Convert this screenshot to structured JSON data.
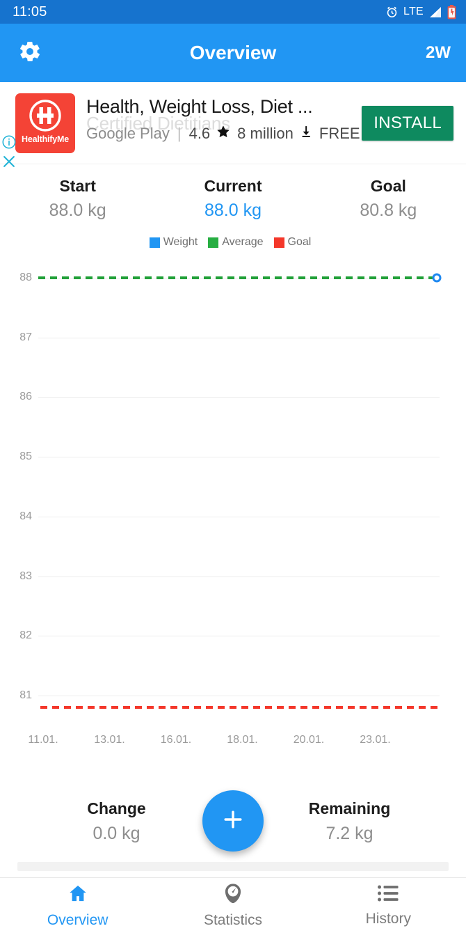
{
  "status_bar": {
    "time": "11:05",
    "network": "LTE",
    "icons": [
      "alarm-icon",
      "signal-icon",
      "battery-charging-icon"
    ]
  },
  "app_bar": {
    "title": "Overview",
    "settings_icon": "gear-icon",
    "range_label": "2W"
  },
  "ad": {
    "app_name": "HealthifyMe",
    "title": "Health, Weight Loss, Diet ...",
    "ghost_subtitle": "Certified Dietitians",
    "store": "Google Play",
    "separator": "|",
    "rating": "4.6",
    "star_icon": "star-icon",
    "installs": "8 million",
    "download_icon": "download-icon",
    "price": "FREE",
    "install_label": "INSTALL",
    "info_icon": "info-icon",
    "close_icon": "close-icon",
    "icon_bg": "#F44336",
    "install_bg": "#0E8A5F"
  },
  "stats": [
    {
      "label": "Start",
      "value": "88.0 kg",
      "accent": false
    },
    {
      "label": "Current",
      "value": "88.0 kg",
      "accent": true
    },
    {
      "label": "Goal",
      "value": "80.8 kg",
      "accent": false
    }
  ],
  "legend": [
    {
      "label": "Weight",
      "color": "#2196F3"
    },
    {
      "label": "Average",
      "color": "#27AE42"
    },
    {
      "label": "Goal",
      "color": "#F4372A"
    }
  ],
  "footer": [
    {
      "label": "Change",
      "value": "0.0 kg"
    },
    {
      "label": "Remaining",
      "value": "7.2 kg"
    }
  ],
  "fab": {
    "icon": "plus-icon",
    "color": "#2196F3"
  },
  "bottom_nav": [
    {
      "label": "Overview",
      "icon": "home-icon",
      "active": true
    },
    {
      "label": "Statistics",
      "icon": "scale-icon",
      "active": false
    },
    {
      "label": "History",
      "icon": "list-icon",
      "active": false
    }
  ],
  "chart_data": {
    "type": "line",
    "title": "",
    "xlabel": "",
    "ylabel": "",
    "ylim": [
      80.5,
      88.3
    ],
    "y_ticks": [
      88,
      87,
      86,
      85,
      84,
      83,
      82,
      81
    ],
    "x_tick_labels": [
      "11.01.",
      "13.01.",
      "16.01.",
      "18.01.",
      "20.01.",
      "23.01."
    ],
    "grid": true,
    "legend_position": "top-center",
    "series": [
      {
        "name": "Weight",
        "color": "#2196F3",
        "style": "marker",
        "points": [
          {
            "x": "23.01.",
            "y": 88.0
          }
        ]
      },
      {
        "name": "Average",
        "color": "#27AE42",
        "style": "dashed-horizontal",
        "value": 88.0
      },
      {
        "name": "Goal",
        "color": "#F4372A",
        "style": "dashed-horizontal",
        "value": 80.8
      }
    ]
  }
}
